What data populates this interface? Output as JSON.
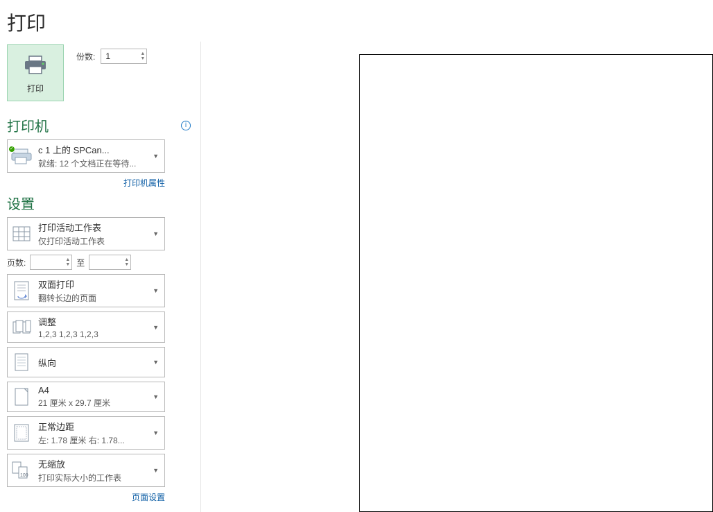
{
  "title": "打印",
  "print": {
    "button_label": "打印",
    "copies_label": "份数:",
    "copies_value": "1"
  },
  "printer": {
    "section_title": "打印机",
    "name": "c            1 上的 SPCan...",
    "status": "就绪: 12 个文档正在等待...",
    "properties_link": "打印机属性"
  },
  "settings": {
    "section_title": "设置",
    "what": {
      "title": "打印活动工作表",
      "subtitle": "仅打印活动工作表"
    },
    "pages": {
      "label": "页数:",
      "from_value": "",
      "to_label": "至",
      "to_value": ""
    },
    "duplex": {
      "title": "双面打印",
      "subtitle": "翻转长边的页面"
    },
    "collate": {
      "title": "调整",
      "subtitle": "1,2,3    1,2,3    1,2,3"
    },
    "orientation": {
      "title": "纵向",
      "subtitle": ""
    },
    "paper": {
      "title": "A4",
      "subtitle": "21 厘米 x 29.7 厘米"
    },
    "margins": {
      "title": "正常边距",
      "subtitle": "左: 1.78 厘米  右: 1.78..."
    },
    "scaling": {
      "title": "无缩放",
      "subtitle": "打印实际大小的工作表"
    },
    "page_setup_link": "页面设置"
  }
}
